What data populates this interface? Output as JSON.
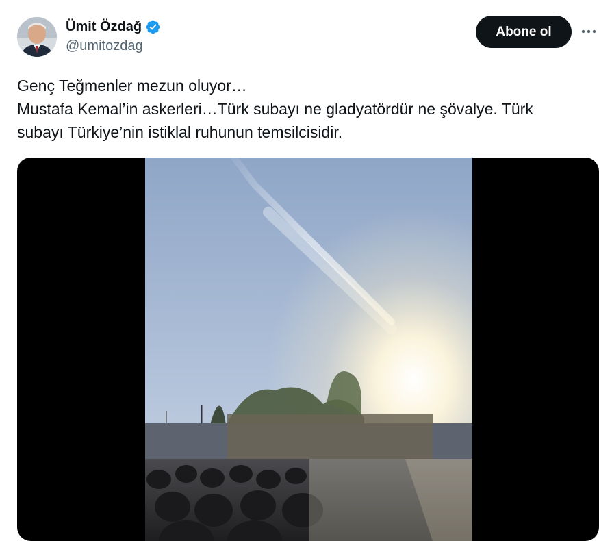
{
  "author": {
    "display_name": "Ümit Özdağ",
    "handle": "@umitozdag",
    "verified_icon": "verified-badge-icon",
    "badge_color": "#1d9bf0"
  },
  "actions": {
    "follow_label": "Abone ol",
    "more_icon": "more-horizontal-icon"
  },
  "tweet": {
    "lines": [
      "Genç Teğmenler mezun oluyor…",
      "Mustafa Kemal’in askerleri…Türk subayı ne gladyatördür ne şövalye. Türk",
      "subayı Türkiye’nin istiklal ruhunun temsilcisidir."
    ]
  },
  "media": {
    "type": "video",
    "colors": {
      "letterbox": "#000000",
      "sky_top": "#8fa6c7",
      "sky_bottom": "#c5d2e4",
      "sun": "#fff6dc",
      "crowd": "#2a2a2c"
    }
  },
  "colors": {
    "text_primary": "#0f1419",
    "text_secondary": "#536471",
    "button_bg": "#0f1419",
    "button_text": "#ffffff"
  }
}
